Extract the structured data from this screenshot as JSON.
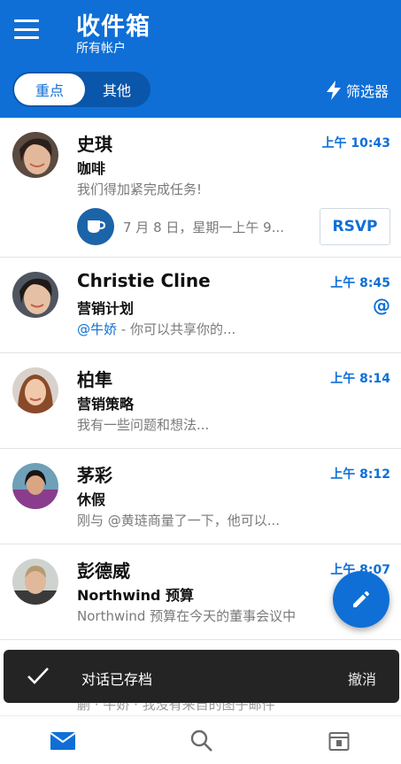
{
  "header": {
    "title": "收件箱",
    "subtitle": "所有帐户",
    "tabs": [
      {
        "label": "重点",
        "selected": true
      },
      {
        "label": "其他",
        "selected": false
      }
    ],
    "filter_label": "筛选器"
  },
  "messages": [
    {
      "sender": "史琪",
      "time": "上午 10:43",
      "subject": "咖啡",
      "preview": "我们得加紧完成任务!",
      "event_text": "7 月 8 日，星期一上午 9...",
      "rsvp_label": "RSVP"
    },
    {
      "sender": "Christie Cline",
      "time": "上午 8:45",
      "subject": "营销计划",
      "preview_mention": "@牛娇",
      "preview": " - 你可以共享你的...",
      "at_symbol": "@"
    },
    {
      "sender": "柏隼",
      "time": "上午 8:14",
      "subject": "营销策略",
      "preview": "我有一些问题和想法..."
    },
    {
      "sender": "茅彩",
      "time": "上午 8:12",
      "subject": "休假",
      "preview": "刚与 @黄琏商量了一下，他可以..."
    },
    {
      "sender": "彭德威",
      "time": "上午 8:07",
      "subject": "Northwind 预算",
      "preview": "Northwind 预算在今天的董事会议中"
    }
  ],
  "snackbar": {
    "message": "对话已存档",
    "action": "撤消"
  },
  "peek_text": "蒯 · 牛娇 · 我没有来自的图子邮件",
  "colors": {
    "accent": "#0f6fd6",
    "snackbar": "#242424"
  }
}
